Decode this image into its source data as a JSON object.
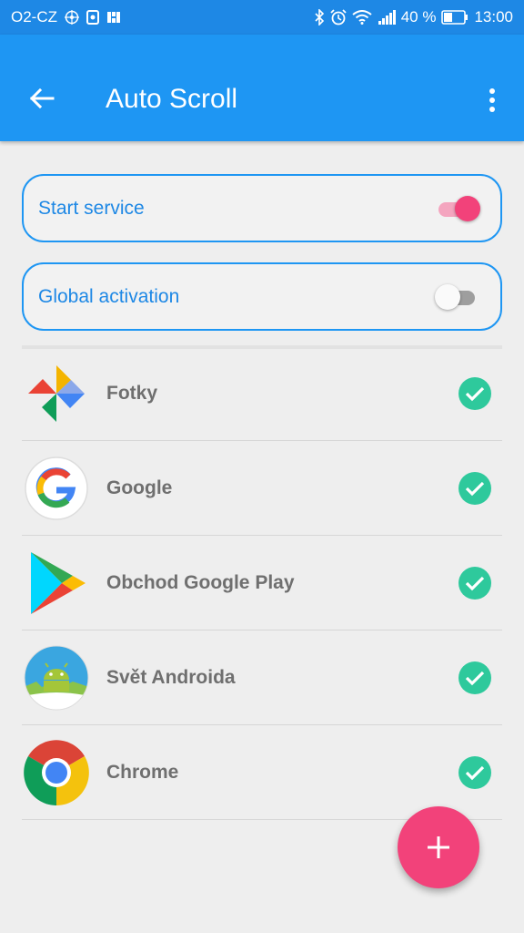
{
  "status_bar": {
    "carrier": "O2-CZ",
    "battery": "40 %",
    "time": "13:00",
    "icons": [
      "sim-icon",
      "nfc-icon",
      "bluetooth-icon",
      "alarm-icon",
      "wifi-icon",
      "signal-icon",
      "battery-icon"
    ]
  },
  "app_bar": {
    "title": "Auto Scroll",
    "back_icon": "back-arrow-icon",
    "menu_icon": "more-vert-icon"
  },
  "settings": {
    "start_service": {
      "label": "Start service",
      "enabled": true
    },
    "global_activation": {
      "label": "Global activation",
      "enabled": false
    }
  },
  "apps": [
    {
      "name": "Fotky",
      "icon": "photos-icon",
      "checked": true
    },
    {
      "name": "Google",
      "icon": "google-icon",
      "checked": true
    },
    {
      "name": "Obchod Google Play",
      "icon": "play-store-icon",
      "checked": true
    },
    {
      "name": "Svět Androida",
      "icon": "svet-androida-icon",
      "checked": true
    },
    {
      "name": "Chrome",
      "icon": "chrome-icon",
      "checked": true
    }
  ],
  "fab": {
    "icon": "plus-icon"
  },
  "colors": {
    "primary": "#1e96f3",
    "status_bar": "#1e88e5",
    "accent": "#f2427a",
    "check": "#2ec99c"
  }
}
